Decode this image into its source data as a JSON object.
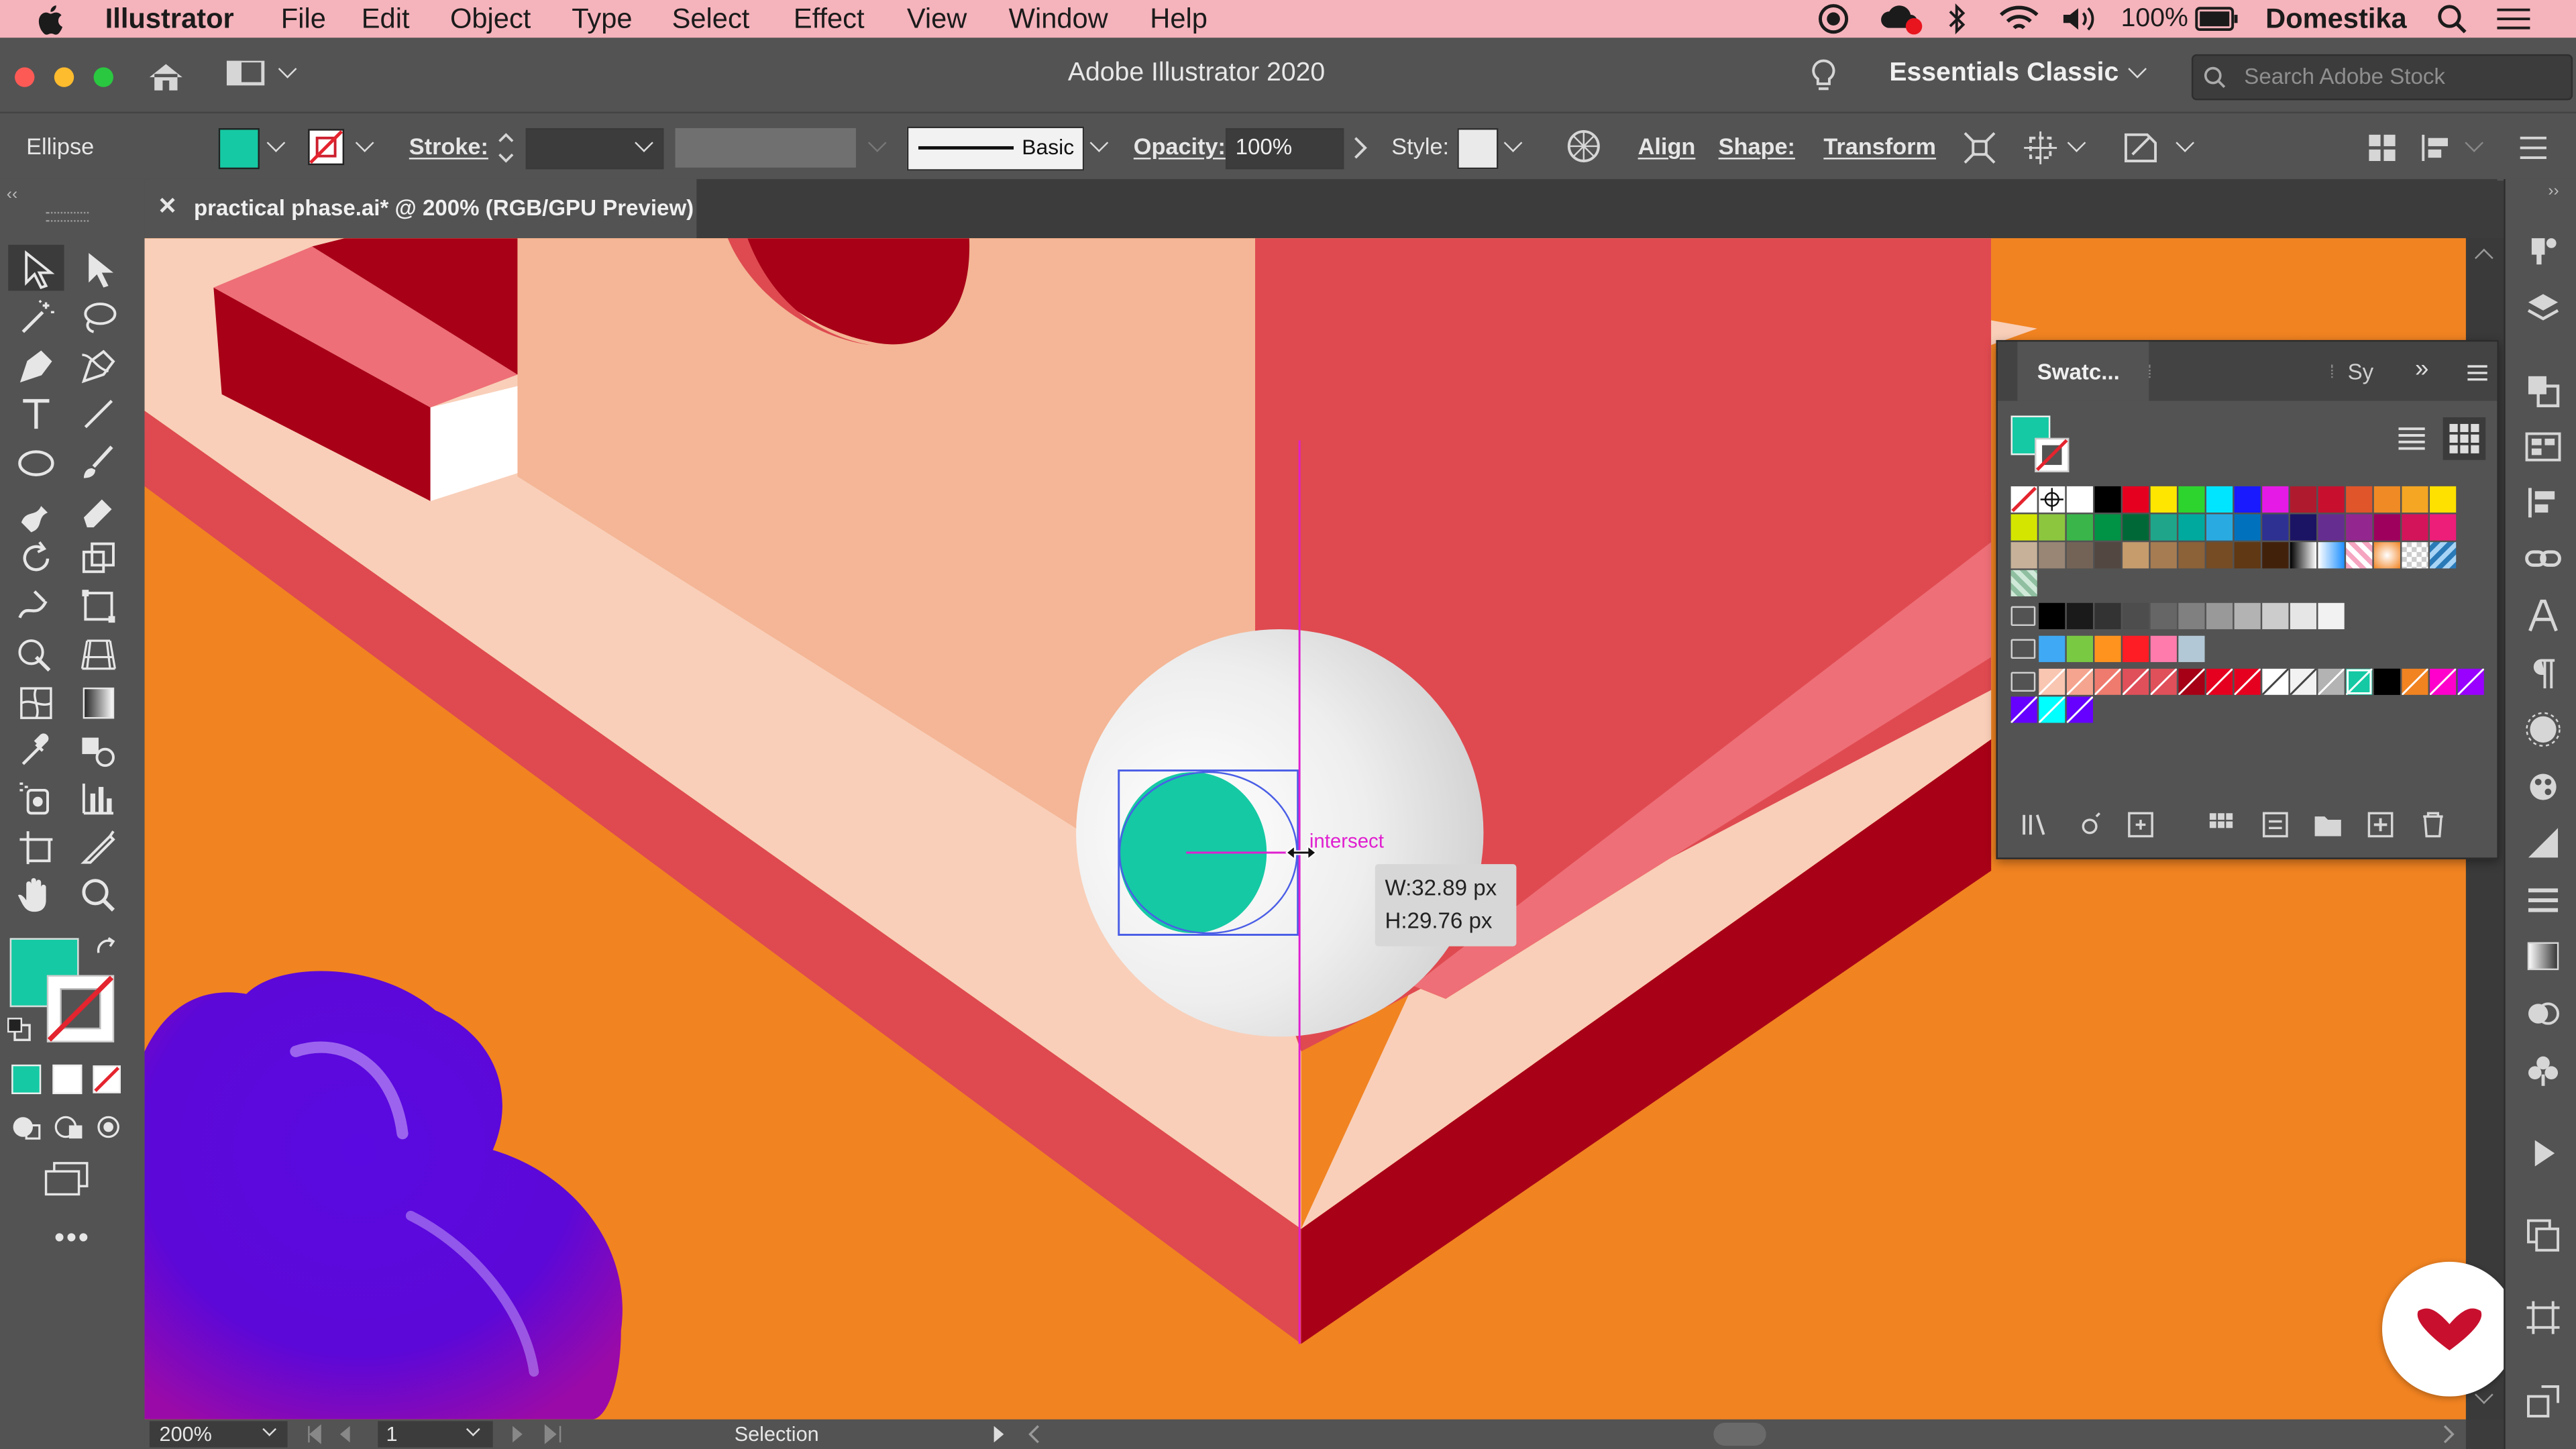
{
  "menubar": {
    "app": "Illustrator",
    "items": [
      "File",
      "Edit",
      "Object",
      "Type",
      "Select",
      "Effect",
      "View",
      "Window",
      "Help"
    ],
    "battery": "100%",
    "user": "Domestika"
  },
  "titlebar": {
    "title": "Adobe Illustrator 2020",
    "workspace": "Essentials Classic",
    "search_placeholder": "Search Adobe Stock"
  },
  "controlbar": {
    "selection_label": "Ellipse",
    "stroke_label": "Stroke:",
    "brush_label": "Basic",
    "opacity_label": "Opacity:",
    "opacity_value": "100%",
    "style_label": "Style:",
    "align_label": "Align",
    "shape_label": "Shape:",
    "transform_label": "Transform"
  },
  "document": {
    "tab_title": "practical phase.ai* @ 200% (RGB/GPU Preview)"
  },
  "canvas": {
    "smart_guide_label": "intersect",
    "tooltip_w": "W:32.89 px",
    "tooltip_h": "H:29.76 px"
  },
  "swatches_panel": {
    "tab_swatches": "Swatc...",
    "tab_symbols": "Sy",
    "row1": [
      "#ffffff",
      "#000000",
      "#e6001f",
      "#ffe600",
      "#2ed42e",
      "#00e5ff",
      "#1a1aff",
      "#e61ae6",
      "#b01a2e",
      "#c8102e",
      "#e0552a",
      "#f08a24",
      "#f5a623",
      "#ffe100"
    ],
    "row2": [
      "#d4e600",
      "#8cc63f",
      "#39b54a",
      "#009245",
      "#006837",
      "#1fa68a",
      "#00a99d",
      "#29abe2",
      "#0071bc",
      "#2e3192",
      "#1b1464",
      "#662d91",
      "#93278f",
      "#9e005d",
      "#d4145a",
      "#ed1e79"
    ],
    "row3": [
      "#c7b299",
      "#998675",
      "#736357",
      "#534741",
      "#c69c6d",
      "#a67c52",
      "#8c6239",
      "#754c24",
      "#603813",
      "#42210b"
    ],
    "gray_row": [
      "#000000",
      "#1a1a1a",
      "#333333",
      "#4d4d4d",
      "#666666",
      "#808080",
      "#999999",
      "#b3b3b3",
      "#cccccc",
      "#e6e6e6",
      "#f2f2f2"
    ],
    "group2": [
      "#3fa9f5",
      "#7ac943",
      "#ff931e",
      "#ff1d25",
      "#ff7bac",
      "#b3c8d6"
    ],
    "group3": [
      "#f9c6b2",
      "#f5a58f",
      "#ef7b6e",
      "#e0505a",
      "#a50016",
      "#e6001f",
      "#f2f2f2",
      "#ffffff",
      "#b3b3b3",
      "#15c9a4",
      "#000000",
      "#f18321",
      "#ff00cc",
      "#9900ff"
    ],
    "group3b": [
      "#6600ff",
      "#00ffff",
      "#6600ff"
    ]
  },
  "tools": {
    "fill_color": "#15c9a4"
  },
  "statusbar": {
    "zoom": "200%",
    "artboard": "1",
    "mode": "Selection"
  },
  "colors": {
    "menubar_bg": "#f5b3bb",
    "canvas_bg": "#f18321",
    "teal": "#15c9a4",
    "smart_guide": "#e020d0"
  }
}
